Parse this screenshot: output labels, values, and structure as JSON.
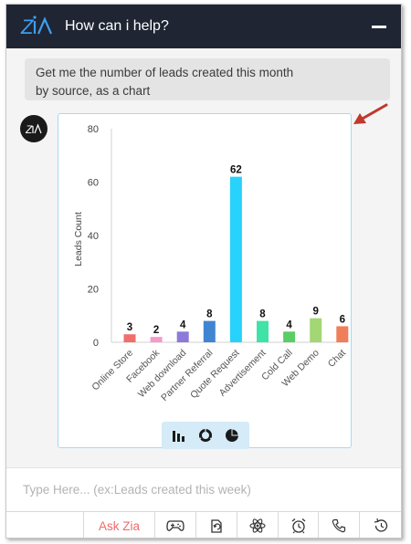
{
  "header": {
    "title": "How can i help?",
    "bg_color": "#1f2532",
    "logo_icon": "zia-logo-icon",
    "minimize_icon": "minimize-icon"
  },
  "user_message": {
    "line1": "Get me the number of leads created this month",
    "line2": "by source, as a chart"
  },
  "bot": {
    "avatar_icon": "zia-avatar-icon"
  },
  "chart_data": {
    "type": "bar",
    "categories": [
      "Online Store",
      "Facebook",
      "Web download",
      "Partner Referral",
      "Quote Request",
      "Advertisement",
      "Cold Call",
      "Web Demo",
      "Chat"
    ],
    "values": [
      3,
      2,
      4,
      8,
      62,
      8,
      4,
      9,
      6
    ],
    "colors": [
      "#ef6f6c",
      "#f59ac9",
      "#8c7ad9",
      "#3f85d1",
      "#27d2fb",
      "#3fe2a7",
      "#5acd64",
      "#a3d774",
      "#f07e58"
    ],
    "ylabel": "Leads Count",
    "ylim": [
      0,
      80
    ],
    "yticks": [
      0,
      20,
      40,
      60,
      80
    ],
    "grid": false,
    "legend": "none"
  },
  "chart_switcher": {
    "options": [
      "bar-chart-icon",
      "donut-chart-icon",
      "pie-chart-icon"
    ],
    "selected": "bar-chart-icon"
  },
  "input": {
    "placeholder": "Type Here... (ex:Leads created this week)",
    "value": ""
  },
  "toolbar": {
    "ask_label": "Ask Zia",
    "accent": "#f06a6a",
    "tools": [
      "gamepad-icon",
      "document-rotate-icon",
      "atom-icon",
      "alarm-clock-icon",
      "phone-icon",
      "history-icon"
    ]
  },
  "annotation": {
    "arrow_color": "#c0392b"
  }
}
